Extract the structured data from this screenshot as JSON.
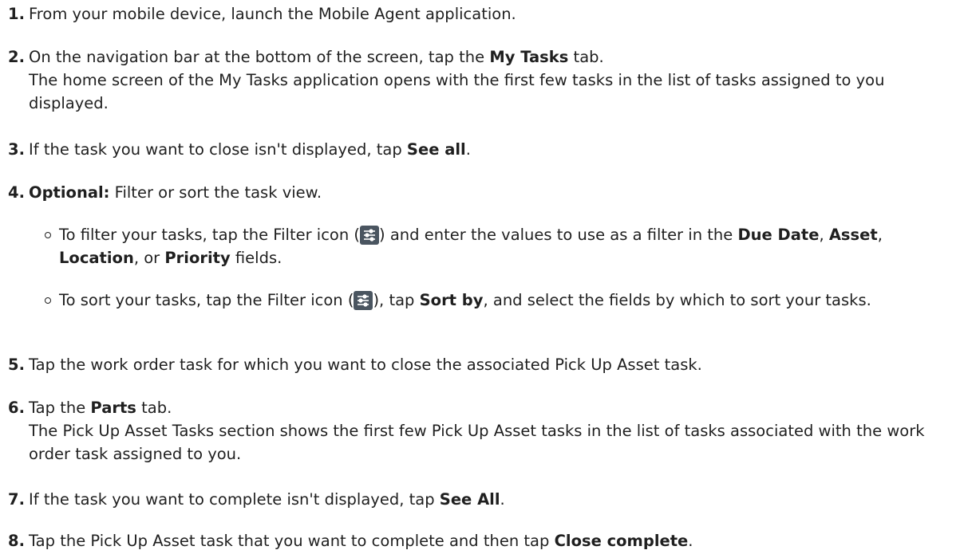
{
  "steps": [
    {
      "num": "1.",
      "text": "From your mobile device, launch the Mobile Agent application."
    },
    {
      "num": "2.",
      "pre": "On the navigation bar at the bottom of the screen, tap the ",
      "bold": "My Tasks",
      "post": " tab.",
      "note": "The home screen of the My Tasks application opens with the first few tasks in the list of tasks assigned to you displayed."
    },
    {
      "num": "3.",
      "pre": "If the task you want to close isn't displayed, tap ",
      "bold": "See all",
      "post": "."
    },
    {
      "num": "4.",
      "bold": "Optional:",
      "post": "  Filter or sort the task view.",
      "bullets": [
        {
          "pre": "To filter your tasks, tap the Filter icon (",
          "mid": ") and enter the values to use as a filter in the ",
          "b1": "Due Date",
          "s1": ", ",
          "b2": "Asset",
          "s2": ", ",
          "b3": "Location",
          "s3": ", or ",
          "b4": "Priority",
          "post": " fields."
        },
        {
          "pre": "To sort your tasks, tap the Filter icon (",
          "mid": "), tap ",
          "b1": "Sort by",
          "post": ", and select the fields by which to sort your tasks."
        }
      ]
    },
    {
      "num": "5.",
      "text": "Tap the work order task for which you want to close the associated Pick Up Asset task."
    },
    {
      "num": "6.",
      "pre": "Tap the ",
      "bold": "Parts",
      "post": " tab.",
      "note": "The Pick Up Asset Tasks section shows the first few Pick Up Asset tasks in the list of tasks associated with the work order task assigned to you."
    },
    {
      "num": "7.",
      "pre": "If the task you want to complete isn't displayed, tap ",
      "bold": "See All",
      "post": "."
    },
    {
      "num": "8.",
      "pre": "Tap the Pick Up Asset task that you want to complete and then tap ",
      "bold": "Close complete",
      "post": "."
    }
  ],
  "icons": {
    "filter": "filter-icon"
  }
}
